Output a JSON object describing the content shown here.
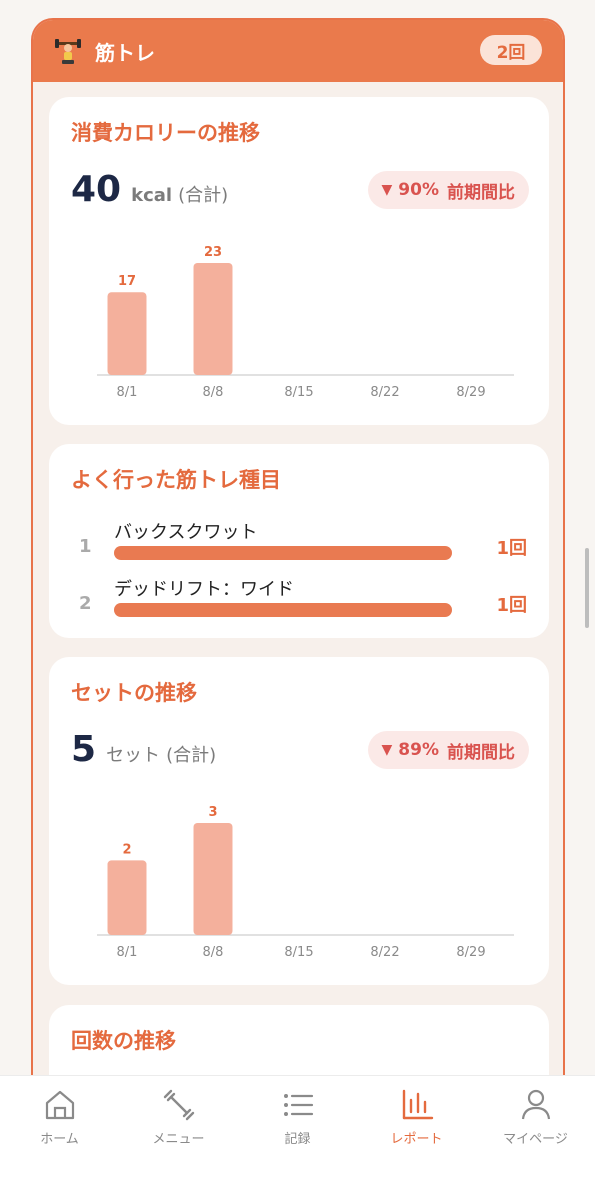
{
  "section": {
    "title": "筋トレ",
    "count_badge": "2回",
    "icon": "dumbbell-icon"
  },
  "calories": {
    "title": "消費カロリーの推移",
    "total_value": "40",
    "total_unit": "kcal",
    "total_suffix": "(合計)",
    "change_arrow": "▼",
    "change_value": "90%",
    "change_label": "前期間比"
  },
  "top_exercises": {
    "title": "よく行った筋トレ種目",
    "items": [
      {
        "rank": "1",
        "name": "バックスクワット",
        "count": "1回",
        "share": 1.0
      },
      {
        "rank": "2",
        "name": "デッドリフト：ワイド",
        "count": "1回",
        "share": 1.0
      }
    ]
  },
  "sets": {
    "title": "セットの推移",
    "total_value": "5",
    "total_unit": "セット",
    "total_suffix": "(合計)",
    "change_arrow": "▼",
    "change_value": "89%",
    "change_label": "前期間比"
  },
  "reps": {
    "title": "回数の推移"
  },
  "chart_data": [
    {
      "type": "bar",
      "categories": [
        "8/1",
        "8/8",
        "8/15",
        "8/22",
        "8/29"
      ],
      "values": [
        17,
        23,
        null,
        null,
        null
      ],
      "ylim": [
        0,
        23
      ],
      "grid": false,
      "color": "#f4b09c"
    },
    {
      "type": "bar",
      "categories": [
        "8/1",
        "8/8",
        "8/15",
        "8/22",
        "8/29"
      ],
      "values": [
        2,
        3,
        null,
        null,
        null
      ],
      "ylim": [
        0,
        3
      ],
      "grid": false,
      "color": "#f4b09c"
    }
  ],
  "tabbar": {
    "items": [
      {
        "label": "ホーム",
        "icon": "home-icon"
      },
      {
        "label": "メニュー",
        "icon": "dumbbell-icon"
      },
      {
        "label": "記録",
        "icon": "list-icon"
      },
      {
        "label": "レポート",
        "icon": "bar-chart-icon"
      },
      {
        "label": "マイページ",
        "icon": "person-icon"
      }
    ],
    "active_index": 3
  },
  "colors": {
    "accent": "#e46a3e",
    "header": "#ea7a4c",
    "bar": "#f4b09c",
    "down": "#d9534f"
  }
}
